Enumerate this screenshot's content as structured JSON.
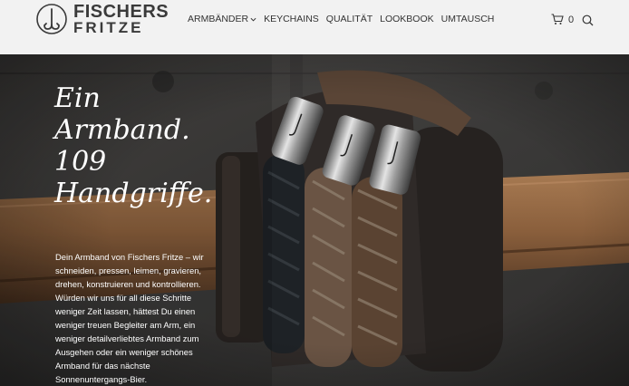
{
  "logo": {
    "top": "FISCHERS",
    "bottom": "FRITZE",
    "mark_icon": "fishhook-circle-icon"
  },
  "nav": {
    "items": [
      {
        "label": "ARMBÄNDER",
        "has_dropdown": true
      },
      {
        "label": "KEYCHAINS"
      },
      {
        "label": "QUALITÄT"
      },
      {
        "label": "LOOKBOOK"
      },
      {
        "label": "UMTAUSCH"
      }
    ]
  },
  "header_actions": {
    "cart_icon": "cart-icon",
    "cart_count": "0",
    "search_icon": "search-icon"
  },
  "hero": {
    "headline": [
      "Ein",
      "Armband.",
      "109",
      "Handgriffe."
    ],
    "body": "Dein Armband von Fischers Fritze – wir schneiden, pressen, leimen, gravieren, drehen, konstruieren und kontrollieren. Würden wir uns für all diese Schritte weniger Zeit lassen, hättest Du einen weniger treuen Begleiter am Arm, ein weniger detailverliebtes Armband zum Ausgehen oder ein weniger schönes Armband für das nächste Sonnenuntergangs-Bier."
  },
  "colors": {
    "header_bg": "#f2f2f2",
    "hero_bg": "#3e3d3c",
    "text_dark": "#333333",
    "text_light": "#ffffff"
  }
}
